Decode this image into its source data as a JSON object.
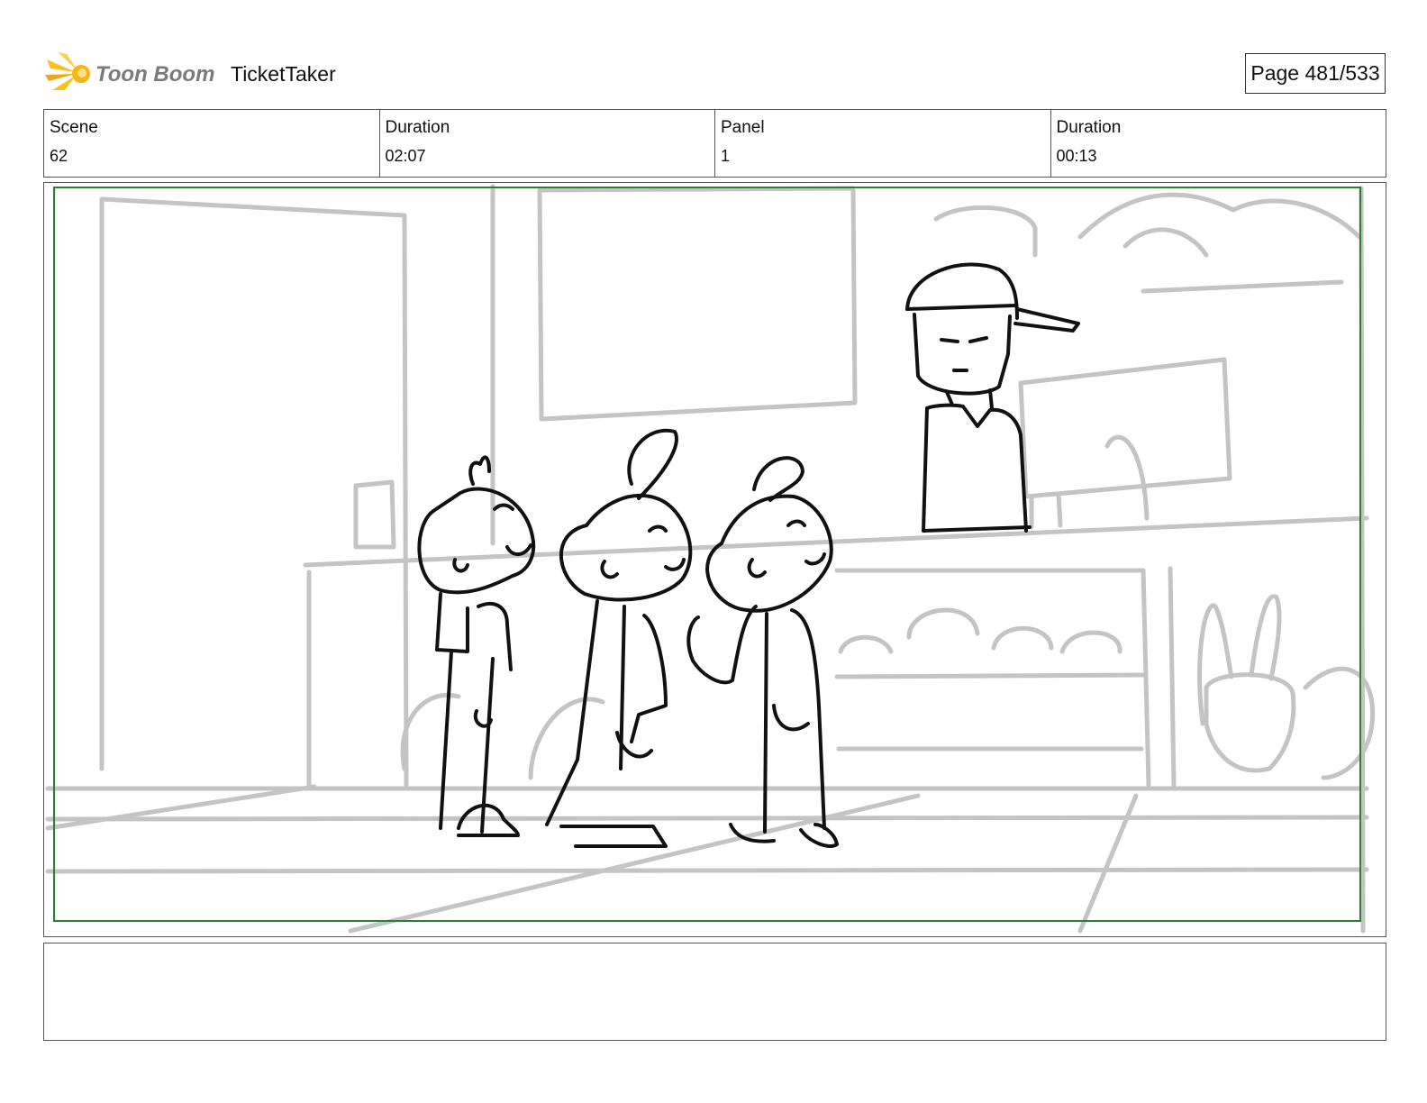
{
  "header": {
    "brand": "Toon Boom",
    "project_title": "TicketTaker",
    "page_indicator": "Page 481/533"
  },
  "info": {
    "scene_label": "Scene",
    "scene_value": "62",
    "scene_duration_label": "Duration",
    "scene_duration_value": "02:07",
    "panel_label": "Panel",
    "panel_value": "1",
    "panel_duration_label": "Duration",
    "panel_duration_value": "00:13"
  },
  "panel": {
    "safe_frame_color": "#2e7d32",
    "background_sketch_color": "#c4c4c4",
    "character_ink_color": "#111111"
  },
  "notes": {
    "text": ""
  }
}
